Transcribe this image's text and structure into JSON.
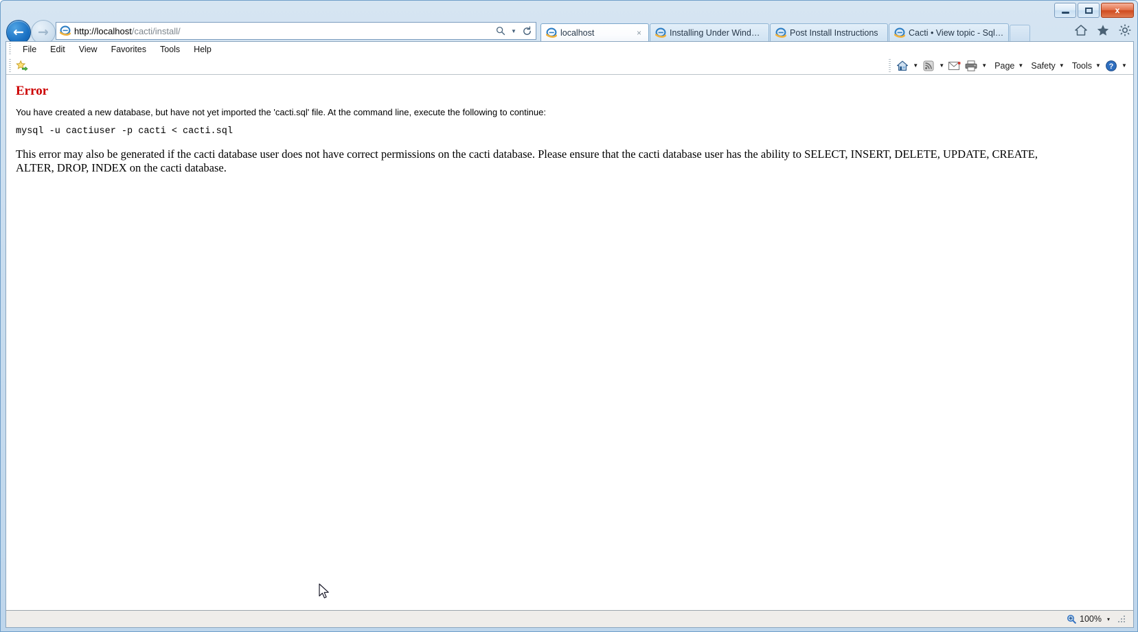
{
  "window": {
    "controls": {
      "minimize_label": "Minimize",
      "maximize_label": "Maximize",
      "close_label": "x"
    }
  },
  "navigation": {
    "back_label": "←",
    "forward_label": "→",
    "address": {
      "host": "http://localhost",
      "path": "/cacti/install/",
      "full": "http://localhost/cacti/install/"
    },
    "search_icon": "search-icon",
    "refresh_icon": "refresh-icon",
    "right_icons": [
      "home-icon",
      "favorites-star-icon",
      "tools-gear-icon"
    ]
  },
  "tabs": [
    {
      "label": "localhost",
      "active": true,
      "closable": true,
      "close_label": "×"
    },
    {
      "label": "Installing Under Windows",
      "active": false,
      "closable": false
    },
    {
      "label": "Post Install Instructions",
      "active": false,
      "closable": false
    },
    {
      "label": "Cacti • View topic - Sql err...",
      "active": false,
      "closable": false
    }
  ],
  "menubar": {
    "items": [
      "File",
      "Edit",
      "View",
      "Favorites",
      "Tools",
      "Help"
    ]
  },
  "favorites_bar": {
    "add_to_favorites_label": "Add to Favorites Bar"
  },
  "command_bar": {
    "items": [
      {
        "name": "home",
        "type": "icon",
        "icon": "home-icon",
        "has_caret": true
      },
      {
        "name": "feeds",
        "type": "icon",
        "icon": "rss-feed-icon",
        "has_caret": true
      },
      {
        "name": "read-mail",
        "type": "icon",
        "icon": "mail-icon",
        "has_caret": false
      },
      {
        "name": "print",
        "type": "icon",
        "icon": "printer-icon",
        "has_caret": true
      },
      {
        "name": "page",
        "type": "text",
        "label": "Page",
        "has_caret": true
      },
      {
        "name": "safety",
        "type": "text",
        "label": "Safety",
        "has_caret": true
      },
      {
        "name": "tools",
        "type": "text",
        "label": "Tools",
        "has_caret": true
      },
      {
        "name": "help",
        "type": "icon",
        "icon": "help-question-icon",
        "has_caret": true
      }
    ]
  },
  "page": {
    "heading": "Error",
    "heading_color": "#cc0000",
    "intro": "You have created a new database, but have not yet imported the 'cacti.sql' file. At the command line, execute the following to continue:",
    "command": "mysql -u cactiuser -p cacti < cacti.sql",
    "note": "This error may also be generated if the cacti database user does not have correct permissions on the cacti database. Please ensure that the cacti database user has the ability to SELECT, INSERT, DELETE, UPDATE, CREATE, ALTER, DROP, INDEX on the cacti database."
  },
  "status_bar": {
    "left_text": "",
    "zoom_level": "100%",
    "zoom_caret": "▾"
  }
}
